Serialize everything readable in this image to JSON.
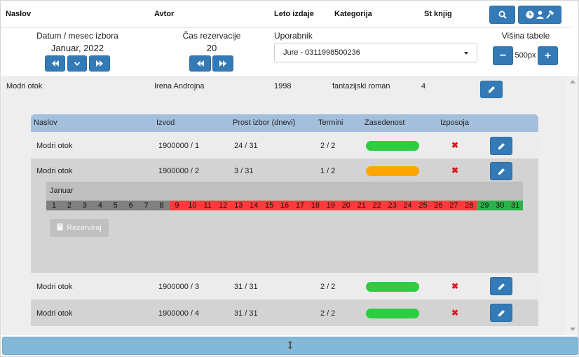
{
  "header": {
    "col_naslov": "Naslov",
    "col_avtor": "Avtor",
    "col_leto": "Leto izdaje",
    "col_kategorija": "Kategorija",
    "col_st": "St knjig"
  },
  "icons": {
    "search": "search-icon",
    "history": "clock-icon",
    "user": "user-icon",
    "gavel": "gavel-icon",
    "edit": "pencil-icon",
    "resize": "resize-vertical-icon"
  },
  "controls": {
    "date_label": "Datum / mesec izbora",
    "date_value": "Januar, 2022",
    "time_label": "Čas rezervacije",
    "time_value": "20",
    "user_label": "Uporabnik",
    "user_value": "Jure - 0311998500236",
    "height_label": "Višina tabele",
    "height_value": "500px",
    "minus": "−",
    "plus": "+"
  },
  "book": {
    "naslov": "Modri otok",
    "avtor": "Irena Androjna",
    "leto": "1998",
    "kategorija": "fantazijski roman",
    "st": "4"
  },
  "copies_header": {
    "naslov": "Naslov",
    "izvod": "Izvod",
    "prost": "Prost izbor (dnevi)",
    "termini": "Termini",
    "zasedenost": "Zasedenost",
    "izposoja": "Izposoja"
  },
  "copies": [
    {
      "naslov": "Modri otok",
      "izvod": "1900000 / 1",
      "prost": "24 / 31",
      "termini": "2 / 2",
      "status_color": "#2ecc40",
      "izposoja": "✖"
    },
    {
      "naslov": "Modri otok",
      "izvod": "1900000 / 2",
      "prost": "3 / 31",
      "termini": "1 / 2",
      "status_color": "#ffa500",
      "izposoja": "✖"
    },
    {
      "naslov": "Modri otok",
      "izvod": "1900000 / 3",
      "prost": "31 / 31",
      "termini": "2 / 2",
      "status_color": "#2ecc40",
      "izposoja": "✖"
    },
    {
      "naslov": "Modri otok",
      "izvod": "1900000 / 4",
      "prost": "31 / 31",
      "termini": "2 / 2",
      "status_color": "#2ecc40",
      "izposoja": "✖"
    }
  ],
  "calendar": {
    "month": "Januar",
    "days": [
      "1",
      "2",
      "3",
      "4",
      "5",
      "6",
      "7",
      "8",
      "9",
      "10",
      "11",
      "12",
      "13",
      "14",
      "15",
      "16",
      "17",
      "18",
      "19",
      "20",
      "21",
      "22",
      "23",
      "24",
      "25",
      "26",
      "27",
      "28",
      "29",
      "30",
      "31"
    ],
    "day_status": [
      "past",
      "past",
      "past",
      "past",
      "past",
      "past",
      "past",
      "past",
      "busy",
      "busy",
      "busy",
      "busy",
      "busy",
      "busy",
      "busy",
      "busy",
      "busy",
      "busy",
      "busy",
      "busy",
      "busy",
      "busy",
      "busy",
      "busy",
      "busy",
      "busy",
      "busy",
      "busy",
      "free",
      "free",
      "free"
    ],
    "colors": {
      "past": "#808080",
      "busy": "#ff3b3b",
      "free": "#2bb34a"
    },
    "reserve_label": "Rezerviraj"
  }
}
